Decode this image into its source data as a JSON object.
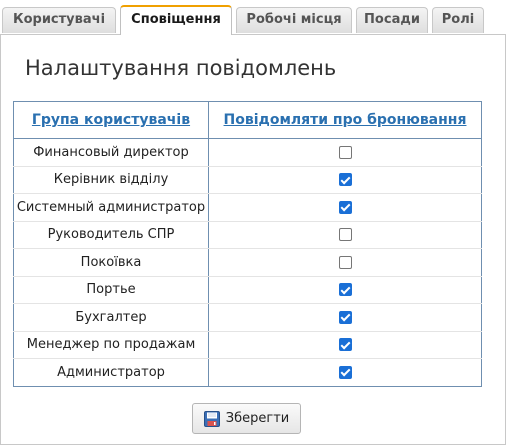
{
  "tabs": [
    {
      "label": "Користувачі",
      "active": false
    },
    {
      "label": "Сповіщення",
      "active": true
    },
    {
      "label": "Робочі місця",
      "active": false
    },
    {
      "label": "Посади",
      "active": false
    },
    {
      "label": "Ролі",
      "active": false
    }
  ],
  "page": {
    "title": "Налаштування повідомлень"
  },
  "table": {
    "headers": [
      "Група користувачів",
      "Повідомляти про бронювання"
    ],
    "rows": [
      {
        "group": "Финансовый директор",
        "notify": false
      },
      {
        "group": "Керівник відділу",
        "notify": true
      },
      {
        "group": "Системный администратор",
        "notify": true
      },
      {
        "group": "Руководитель СПР",
        "notify": false
      },
      {
        "group": "Покоївка",
        "notify": false
      },
      {
        "group": "Портье",
        "notify": true
      },
      {
        "group": "Бухгалтер",
        "notify": true
      },
      {
        "group": "Менеджер по продажам",
        "notify": true
      },
      {
        "group": "Администратор",
        "notify": true
      }
    ]
  },
  "buttons": {
    "save_label": "Зберегти",
    "save_icon": "floppy-disk-icon"
  },
  "colors": {
    "accent_tab": "#f0a000",
    "link": "#2a70b0",
    "checkbox": "#1a6fd6",
    "table_border": "#6f8fb0"
  }
}
